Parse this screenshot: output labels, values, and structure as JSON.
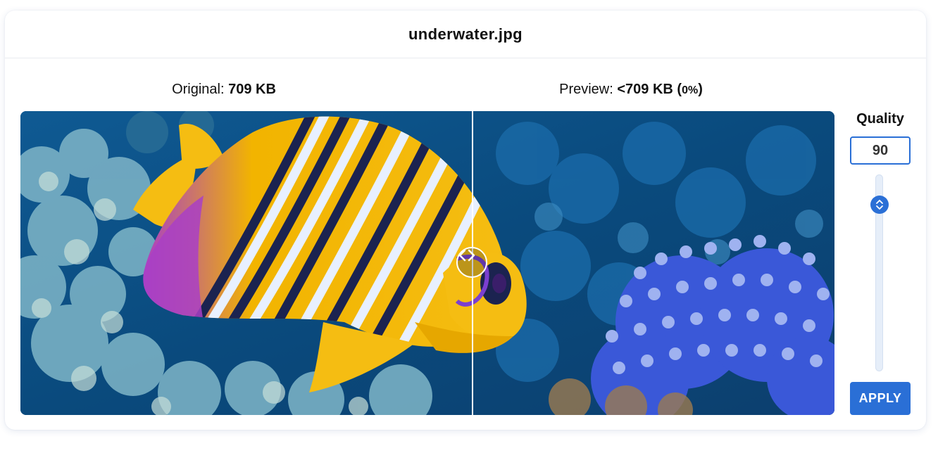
{
  "header": {
    "title": "underwater.jpg"
  },
  "original": {
    "label": "Original: ",
    "size": "709 KB"
  },
  "preview": {
    "label": "Preview: ",
    "size": "<709 KB (",
    "percent": "0%",
    "close": ")"
  },
  "quality": {
    "title": "Quality",
    "value": "90",
    "slider_level": 0.9
  },
  "apply_button": {
    "label": "APPLY"
  },
  "icons": {
    "compare_handle": "chevron-left-right-icon",
    "slider_thumb": "chevron-up-down-icon"
  },
  "colors": {
    "accent": "#2a6fd6",
    "text": "#111111",
    "divider": "#ffffff"
  }
}
